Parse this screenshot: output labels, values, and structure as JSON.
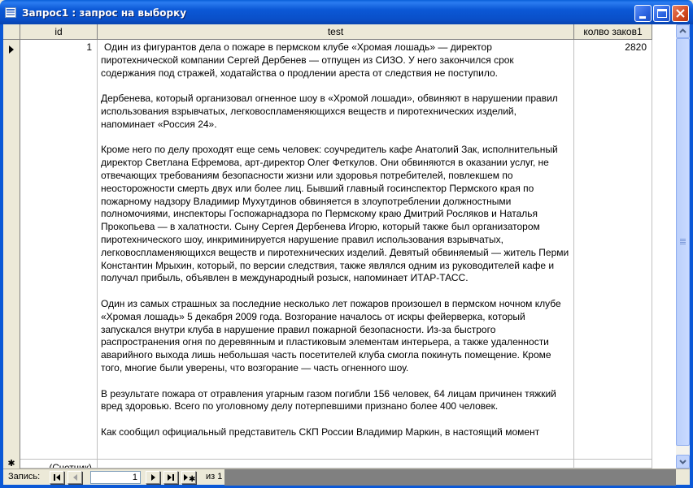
{
  "window": {
    "title": "Запрос1 : запрос на выборку",
    "controls": {
      "minimize": "minimize-icon",
      "maximize": "maximize-icon",
      "close": "close-icon"
    }
  },
  "datasheet": {
    "columns": [
      "id",
      "test",
      "колво заков1"
    ],
    "rows": [
      {
        "id": "1",
        "test": [
          "Один из фигурантов дела о пожаре в пермском клубе «Хромая лошадь» — директор пиротехнической компании Сергей Дербенев — отпущен из СИЗО. У него закончился срок содержания под стражей, ходатайства о продлении ареста от следствия не поступило.",
          "Дербенева, который организовал огненное шоу в «Хромой лошади», обвиняют в нарушении правил использования взрывчатых, легковоспламеняющихся веществ и пиротехнических изделий, напоминает «Россия 24».",
          "Кроме него по делу проходят еще семь человек: соучредитель кафе Анатолий Зак, исполнительный директор Светлана Ефремова, арт-директор Олег Феткулов. Они обвиняются в оказании услуг, не отвечающих требованиям безопасности жизни или здоровья потребителей, повлекшем по неосторожности смерть двух или более лиц. Бывший главный госинспектор Пермского края по пожарному надзору Владимир Мухутдинов обвиняется в злоупотреблении должностными полномочиями, инспекторы Госпожарнадзора по Пермскому краю Дмитрий Росляков и Наталья Прокопьева — в халатности. Сыну Сергея Дербенева Игорю, который также был организатором пиротехнического шоу, инкриминируется нарушение правил использования взрывчатых, легковоспламеняющихся веществ и пиротехнических изделий. Девятый обвиняемый — житель Перми Константин Мрыхин, который, по версии следствия, также являлся одним из руководителей кафе и получал прибыль, объявлен в международный розыск, напоминает ИТАР-ТАСС.",
          "Один из самых страшных за последние несколько лет пожаров произошел в пермском ночном клубе «Хромая лошадь» 5 декабря 2009 года. Возгорание началось от искры фейерверка, который запускался внутри клуба в нарушение правил пожарной безопасности. Из-за быстрого распространения огня по деревянным и пластиковым элементам интерьера, а также удаленности аварийного выхода лишь небольшая часть посетителей клуба смогла покинуть помещение. Кроме того, многие были уверены, что возгорание — часть огненного шоу.",
          "В результате пожара от отравления угарным газом погибли 156 человек, 64 лицам причинен тяжкий вред здоровью. Всего по уголовному делу потерпевшими признано более 400 человек.",
          "Как сообщил официальный представитель СКП России Владимир Маркин, в настоящий момент"
        ],
        "count": "2820"
      }
    ],
    "new_row": {
      "selector": "✱",
      "id_placeholder": "(Счетчик)"
    },
    "current_row_marker": "current-record-arrow-icon"
  },
  "navigation": {
    "label": "Запись:",
    "current_record": "1",
    "of_label": "из  1",
    "buttons": [
      "first-record-icon",
      "prev-record-icon",
      "next-record-icon",
      "last-record-icon",
      "new-record-icon"
    ]
  }
}
